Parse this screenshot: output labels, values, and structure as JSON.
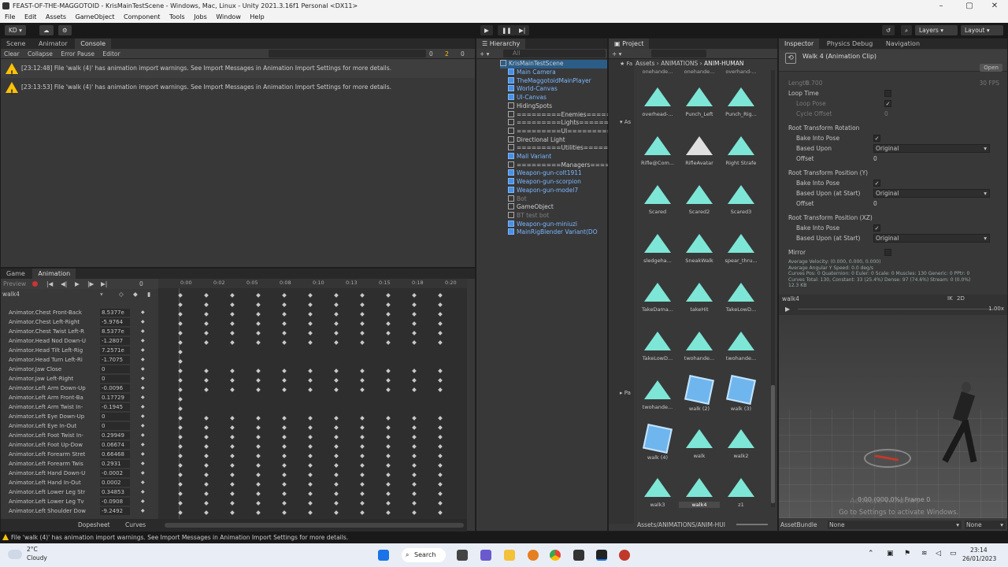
{
  "window": {
    "title": "FEAST-OF-THE-MAGGOTOID - KrisMainTestScene - Windows, Mac, Linux - Unity 2021.3.16f1 Personal <DX11>"
  },
  "menu": [
    "File",
    "Edit",
    "Assets",
    "GameObject",
    "Component",
    "Tools",
    "Jobs",
    "Window",
    "Help"
  ],
  "toolbar": {
    "account": "KD",
    "layers": "Layers",
    "layout": "Layout"
  },
  "console": {
    "tabs": [
      "Scene",
      "Animator",
      "Console"
    ],
    "buttons": [
      "Clear",
      "Collapse",
      "Error Pause",
      "Editor"
    ],
    "counts": [
      "0",
      "2",
      "0"
    ],
    "rows": [
      "[23:12:48] File 'walk (4)' has animation import warnings. See Import Messages in Animation Import Settings for more details.",
      "[23:13:53] File 'walk (4)' has animation import warnings. See Import Messages in Animation Import Settings for more details."
    ]
  },
  "hierarchy": {
    "tab": "Hierarchy",
    "search": "All",
    "scene": "KrisMainTestScene",
    "items": [
      {
        "label": "Main Camera",
        "type": "prefab"
      },
      {
        "label": "TheMaggotoidMainPlayer",
        "type": "prefab"
      },
      {
        "label": "World-Canvas",
        "type": "prefab"
      },
      {
        "label": "UI-Canvas",
        "type": "prefab"
      },
      {
        "label": "HidingSpots",
        "type": "normal"
      },
      {
        "label": "=========Enemies=========",
        "type": "normal"
      },
      {
        "label": "=========Lights=========",
        "type": "normal"
      },
      {
        "label": "=========UI=========",
        "type": "normal"
      },
      {
        "label": "Directional Light",
        "type": "normal"
      },
      {
        "label": "=========Utilities=========",
        "type": "normal"
      },
      {
        "label": "Mall Variant",
        "type": "prefab"
      },
      {
        "label": "=========Managers=========",
        "type": "normal"
      },
      {
        "label": "Weapon-gun-colt1911",
        "type": "prefab"
      },
      {
        "label": "Weapon-gun-scorpion",
        "type": "prefab"
      },
      {
        "label": "Weapon-gun-model7",
        "type": "prefab"
      },
      {
        "label": "Bot",
        "type": "gray"
      },
      {
        "label": "GameObject",
        "type": "normal"
      },
      {
        "label": "BT test bot",
        "type": "gray"
      },
      {
        "label": "Weapon-gun-miniuzi",
        "type": "prefab"
      },
      {
        "label": "MainRigBlender Variant(DO",
        "type": "prefab"
      }
    ]
  },
  "project": {
    "tab": "Project",
    "breadcrumb": [
      "Assets",
      "ANIMATIONS",
      "ANIM-HUMAN"
    ],
    "top_labels": [
      "onehande...",
      "onehande...",
      "overhand-..."
    ],
    "assets": [
      "overhead-...",
      "Punch_Left",
      "Punch_Rig...",
      "Rifle@Com...",
      "RifleAvatar",
      "Right Strafe",
      "Scared",
      "Scared2",
      "Scared3",
      "sledgeha...",
      "SneakWalk",
      "spear_thru...",
      "TakeDama...",
      "takeHit",
      "TakeLowD...",
      "TakeLowD...",
      "twohande...",
      "twohande...",
      "twohande...",
      "walk (2)",
      "walk (3)",
      "walk (4)",
      "walk",
      "walk2",
      "walk3",
      "walk4",
      "z1"
    ],
    "footer": "Assets/ANIMATIONS/ANIM-HUI"
  },
  "inspector": {
    "tabs": [
      "Inspector",
      "Physics Debug",
      "Navigation"
    ],
    "title": "Walk 4 (Animation Clip)",
    "open": "Open",
    "length_label": "Length",
    "length": "0.700",
    "fps": "30 FPS",
    "loop_time": "Loop Time",
    "loop_pose": "Loop Pose",
    "cycle_offset": "Cycle Offset",
    "cycle_offset_val": "0",
    "rot_header": "Root Transform Rotation",
    "bake": "Bake Into Pose",
    "based_upon": "Based Upon",
    "original": "Original",
    "offset": "Offset",
    "offset_val": "0",
    "posy_header": "Root Transform Position (Y)",
    "based_upon_start": "Based Upon (at Start)",
    "posxz_header": "Root Transform Position (XZ)",
    "mirror": "Mirror",
    "stats": [
      "Average Velocity: (0.000, 0.000, 0.000)",
      "Average Angular Y Speed: 0.0 deg/s",
      "Curves Pos: 0 Quaternion: 0 Euler: 0 Scale: 0 Muscles: 130 Generic: 0 PPtr: 0",
      "Curves Total: 130, Constant: 33 (25.4%) Dense: 97 (74.6%) Stream: 0 (0.0%)",
      "12.3 KB"
    ],
    "preview_name": "walk4",
    "preview_speed": "1.00x",
    "preview_time": "0:00 (000.0%) Frame 0",
    "watermark": "Go to Settings to activate Windows.",
    "watermark_top": "Activate Windows",
    "assetbundle": "AssetBundle",
    "none1": "None",
    "none2": "None"
  },
  "animation": {
    "tabs": [
      "Game",
      "Animation"
    ],
    "preview": "Preview",
    "frame": "0",
    "clip": "walk4",
    "ticks": [
      "0:00",
      "0:02",
      "0:05",
      "0:08",
      "0:10",
      "0:13",
      "0:15",
      "0:18",
      "0:20"
    ],
    "props": [
      {
        "name": "Animator.Chest Front-Back",
        "value": "8.5377e"
      },
      {
        "name": "Animator.Chest Left-Right",
        "value": "-5.9764"
      },
      {
        "name": "Animator.Chest Twist Left-R",
        "value": "8.5377e"
      },
      {
        "name": "Animator.Head Nod Down-U",
        "value": "-1.2807"
      },
      {
        "name": "Animator.Head Tilt Left-Rig",
        "value": "7.2571e"
      },
      {
        "name": "Animator.Head Turn Left-Ri",
        "value": "-1.7075"
      },
      {
        "name": "Animator.Jaw Close",
        "value": "0"
      },
      {
        "name": "Animator.Jaw Left-Right",
        "value": "0"
      },
      {
        "name": "Animator.Left Arm Down-Up",
        "value": "-0.0096"
      },
      {
        "name": "Animator.Left Arm Front-Ba",
        "value": "0.17729"
      },
      {
        "name": "Animator.Left Arm Twist In-",
        "value": "-0.1945"
      },
      {
        "name": "Animator.Left Eye Down-Up",
        "value": "0"
      },
      {
        "name": "Animator.Left Eye In-Out",
        "value": "0"
      },
      {
        "name": "Animator.Left Foot Twist In-",
        "value": "0.29949"
      },
      {
        "name": "Animator.Left Foot Up-Dow",
        "value": "0.06674"
      },
      {
        "name": "Animator.Left Forearm Stret",
        "value": "0.66468"
      },
      {
        "name": "Animator.Left Forearm Twis",
        "value": "0.2931"
      },
      {
        "name": "Animator.Left Hand Down-U",
        "value": "-0.0002"
      },
      {
        "name": "Animator.Left Hand In-Out",
        "value": "0.0002"
      },
      {
        "name": "Animator.Left Lower Leg Str",
        "value": "0.34853"
      },
      {
        "name": "Animator.Left Lower Leg Tv",
        "value": "-0.0908"
      },
      {
        "name": "Animator.Left Shoulder Dow",
        "value": "-9.2492"
      }
    ],
    "bottom_tabs": [
      "Dopesheet",
      "Curves"
    ]
  },
  "status": "File 'walk (4)' has animation import warnings. See Import Messages in Animation Import Settings for more details.",
  "taskbar": {
    "temp": "2°C",
    "weather": "Cloudy",
    "search": "Search",
    "time": "23:14",
    "date": "26/01/2023"
  }
}
